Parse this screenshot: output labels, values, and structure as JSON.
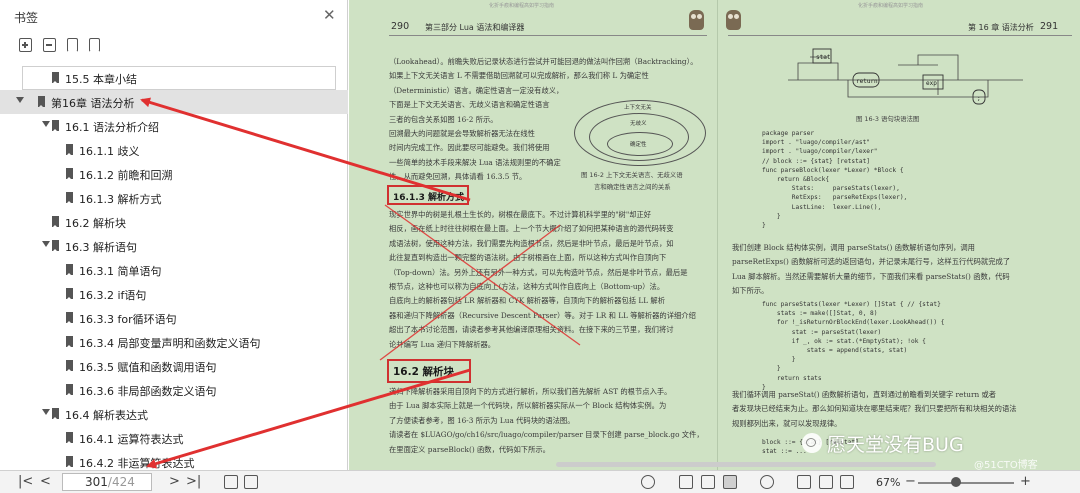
{
  "sidebar": {
    "title": "书签",
    "close_glyph": "✕",
    "tools": [
      "expand-all-icon",
      "collapse-all-icon",
      "add-bookmark-icon",
      "bookmark-icon"
    ],
    "items": [
      {
        "label": "15.5 本章小结",
        "level": 1,
        "expandable": false,
        "boxed": true
      },
      {
        "label": "第16章 语法分析",
        "level": 0,
        "expandable": true,
        "selected": true
      },
      {
        "label": "16.1 语法分析介绍",
        "level": 1,
        "expandable": true
      },
      {
        "label": "16.1.1 歧义",
        "level": 2,
        "expandable": false
      },
      {
        "label": "16.1.2 前瞻和回溯",
        "level": 2,
        "expandable": false
      },
      {
        "label": "16.1.3 解析方式",
        "level": 2,
        "expandable": false
      },
      {
        "label": "16.2 解析块",
        "level": 1,
        "expandable": false
      },
      {
        "label": "16.3 解析语句",
        "level": 1,
        "expandable": true
      },
      {
        "label": "16.3.1 简单语句",
        "level": 2,
        "expandable": false
      },
      {
        "label": "16.3.2 if语句",
        "level": 2,
        "expandable": false
      },
      {
        "label": "16.3.3 for循环语句",
        "level": 2,
        "expandable": false
      },
      {
        "label": "16.3.4 局部变量声明和函数定义语句",
        "level": 2,
        "expandable": false
      },
      {
        "label": "16.3.5 赋值和函数调用语句",
        "level": 2,
        "expandable": false
      },
      {
        "label": "16.3.6 非局部函数定义语句",
        "level": 2,
        "expandable": false
      },
      {
        "label": "16.4 解析表达式",
        "level": 1,
        "expandable": true
      },
      {
        "label": "16.4.1 运算符表达式",
        "level": 2,
        "expandable": false
      },
      {
        "label": "16.4.2 非运算符表达式",
        "level": 2,
        "expandable": false
      }
    ]
  },
  "bottombar": {
    "first": "|<",
    "prev": "<",
    "next": ">",
    "last": ">|",
    "current_page": "301",
    "total_pages": "/424",
    "zoom": "67%",
    "zoom_level": 0.4,
    "zoom_minus": "−",
    "zoom_plus": "+"
  },
  "document": {
    "left_page": {
      "number": "290",
      "header": "第三部分   Lua 语法和编译器",
      "running_head": "化折手痕和编程高如学习指南",
      "paragraphs": [
        "（Lookahead）。前瞻失败后记录状态进行尝试并可能回退的做法叫作回溯（Backtracking）。",
        "如果上下文无关语言 L 不需要借助回溯就可以完成解析，那么我们称 L 为确定性",
        "（Deterministic）语言。确定性语言一定没有歧义，",
        "下面是上下文无关语言、无歧义语言和确定性语言",
        "三者的包含关系如图 16-2 所示。",
        "    回溯最大的问题就是会导致解析器无法在线性",
        "时间内完成工作。因此要尽可能避免。我们将使用",
        "一些简单的技术手段来解决 Lua 语法规则里的不确定",
        "性，从而避免回溯，具体请看 16.3.5 节。"
      ],
      "figure": {
        "outer": "上下文无关",
        "middle": "无歧义",
        "inner": "确定性",
        "caption1": "图 16-2   上下文无关语言、无歧义语",
        "caption2": "言和确定性语言之间的关系"
      },
      "sec1": "16.1.3   解析方式",
      "paragraphs2": [
        "    现实世界中的树是扎根土生长的，树根在最底下。不过计算机科学里的\"树\"却正好",
        "相反，画在纸上时往往树根在最上面。上一个节大概介绍了如何把某种语言的源代码转变",
        "成语法树，使用这种方法，我们需要先构造根节点，然后是非叶节点，最后是叶节点，如",
        "此往复直到构造出一颗完整的语法树。由于树根画在上面，所以这种方式叫作自顶向下",
        "（Top-down）法。另外上还有另外一种方式，可以先构造叶节点，然后是非叶节点，最后是",
        "根节点，这种也可以称为自底向上(方法，这种方式叫作自底向上（Bottom-up）法。",
        "    自底向上的解析器包括 LR 解析器和 CYK 解析器等，自顶向下的解析器包括 LL 解析",
        "器和递归下降解析器（Recursive Descent Parser）等。对于 LR 和 LL 等解析器的详细介绍",
        "超出了本书讨论范围，请读者参考其他编译原理相关资料。在接下来的三节里，我们将讨",
        "论并编写 Lua 递归下降解析器。"
      ],
      "sec2": "16.2   解析块",
      "paragraphs3": [
        "    递归下降解析器采用自顶向下的方式进行解析，所以我们首先解析 AST 的根节点入手。",
        "由于 Lua 脚本实际上就是一个代码块，所以解析器实际从一个 Block 结构体实例。为",
        "了方便读者参考，图 16-3 所示为 Lua 代码块的语法图。",
        "    请读者在 $LUAGO/go/ch16/src/luago/compiler/parser 目录下创建 parse_block.go 文件，",
        "在里面定义 parseBlock() 函数，代码如下所示。"
      ]
    },
    "right_page": {
      "number": "291",
      "header": "第 16 章   语法分析",
      "running_head": "化折手痕和编程高如学习指南",
      "diagram": {
        "stat": "stat",
        "return": "return",
        "exp": "exp",
        "semi": ";",
        "caption": "图 16-3   语句块语法图"
      },
      "code1": [
        "package parser",
        "",
        "import . \"luago/compiler/ast\"",
        "import . \"luago/compiler/lexer\"",
        "",
        "// block ::= {stat} [retstat]",
        "func parseBlock(lexer *Lexer) *Block {",
        "    return &Block{",
        "        Stats:     parseStats(lexer),",
        "        RetExps:   parseRetExps(lexer),",
        "        LastLine:  lexer.Line(),",
        "    }",
        "}"
      ],
      "para1": [
        "    我们创建 Block 结构体实例，调用 parseStats() 函数解析语句序列，调用",
        "parseRetExps() 函数解析可选的返回语句，并记录末尾行号，这样五行代码就完成了",
        "Lua 脚本解析。当然还需要解析大量的细节，下面我们来看 parseStats() 函数，代码",
        "如下所示。"
      ],
      "code2": [
        "func parseStats(lexer *Lexer) []Stat { // {stat}",
        "    stats := make([]Stat, 0, 8)",
        "    for !_isReturnOrBlockEnd(lexer.LookAhead()) {",
        "        stat := parseStat(lexer)",
        "        if _, ok := stat.(*EmptyStat); !ok {",
        "            stats = append(stats, stat)",
        "        }",
        "    }",
        "    return stats",
        "}"
      ],
      "para2": [
        "    我们循环调用 parseStat() 函数解析语句，直到通过前瞻看到关键字 return 或者",
        "者发现块已经结束为止。那么如何知道块在哪里结束呢？我们只要把所有和块相关的语法",
        "规则都列出来，就可以发现规律。"
      ],
      "code3": [
        "block ::= {stat} [retstat]",
        "stat ::= ..."
      ]
    },
    "watermark": "愿天堂没有BUG",
    "watermark2": "@51CTO博客"
  },
  "colors": {
    "page_bg": "#cfe2c4",
    "annotation_red": "#d03030",
    "selected_row": "#e2e2e2"
  }
}
